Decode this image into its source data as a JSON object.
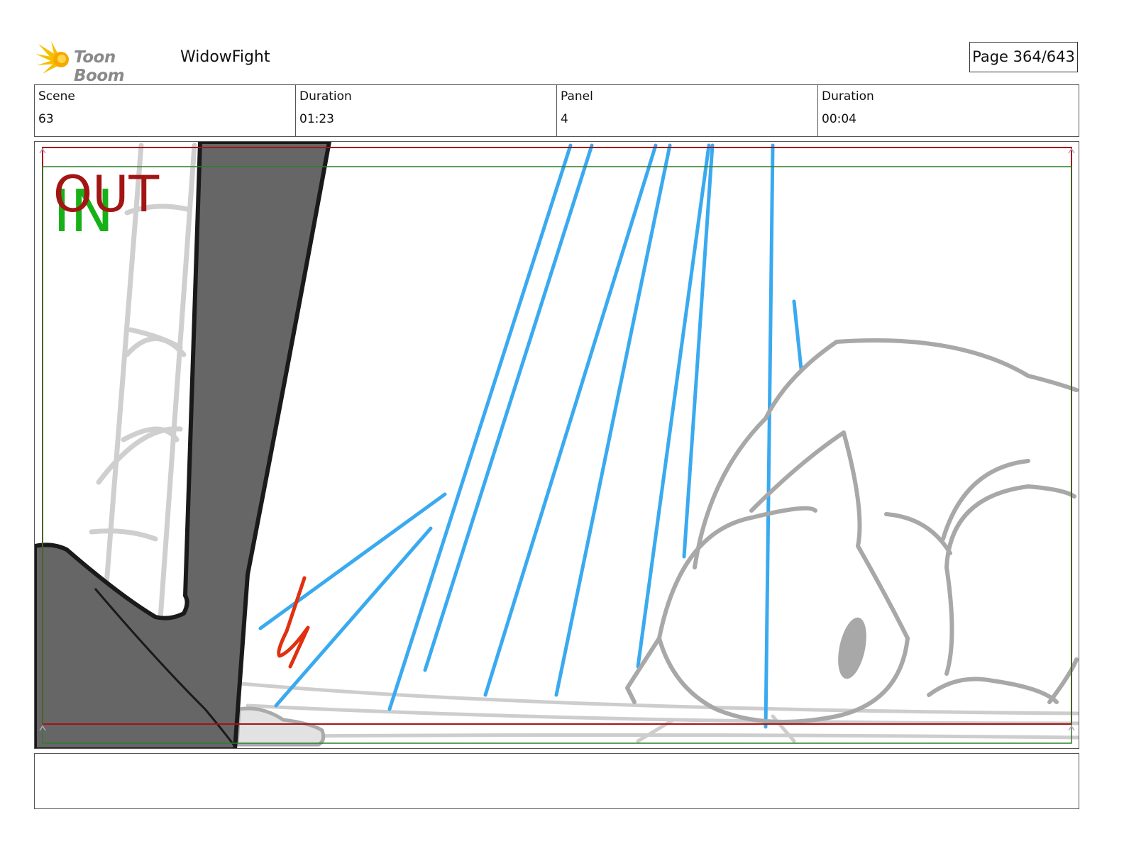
{
  "header": {
    "logo_text": "Toon Boom",
    "project_title": "WidowFight",
    "page_label": "Page 364/643"
  },
  "info": {
    "scene_label": "Scene",
    "scene_value": "63",
    "duration_label": "Duration",
    "duration_value": "01:23",
    "panel_label": "Panel",
    "panel_value": "4",
    "panel_duration_label": "Duration",
    "panel_duration_value": "00:04"
  },
  "panel_overlay": {
    "out_label": "OUT",
    "in_label": "IN"
  },
  "notes": {
    "text": ""
  },
  "colors": {
    "out_frame": "#a31515",
    "in_frame": "#2e7d2e",
    "speed_lines": "#3aaaf0",
    "sketch_gray": "#a8a8a8",
    "ink_red": "#e03010",
    "leg_fill": "#666666"
  }
}
